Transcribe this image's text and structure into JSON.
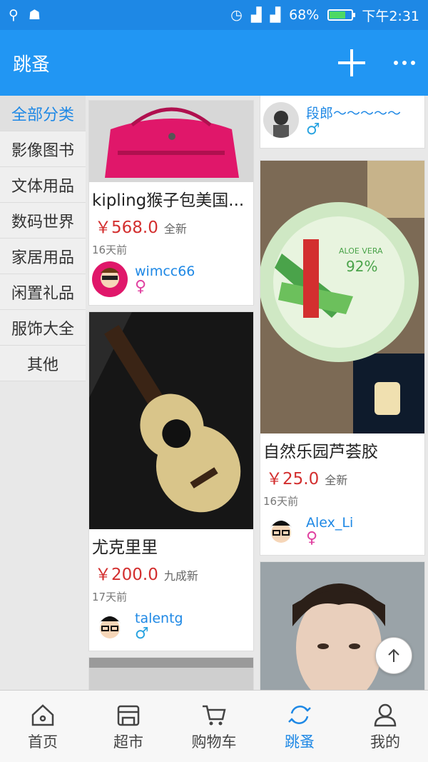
{
  "statusbar": {
    "battery": "68%",
    "time": "下午2:31",
    "battery_level": 0.68
  },
  "appbar": {
    "title": "跳蚤"
  },
  "sidebar": {
    "items": [
      {
        "label": "全部分类",
        "active": true
      },
      {
        "label": "影像图书",
        "active": false
      },
      {
        "label": "文体用品",
        "active": false
      },
      {
        "label": "数码世界",
        "active": false
      },
      {
        "label": "家居用品",
        "active": false
      },
      {
        "label": "闲置礼品",
        "active": false
      },
      {
        "label": "服饰大全",
        "active": false
      },
      {
        "label": "其他",
        "active": false
      }
    ]
  },
  "listings": {
    "left": [
      {
        "title": "kipling猴子包美国...",
        "price": "￥568.0",
        "condition": "全新",
        "date": "16天前",
        "user": "wimcc66",
        "gender": "♀"
      },
      {
        "title": "尤克里里",
        "price": "￥200.0",
        "condition": "九成新",
        "date": "17天前",
        "user": "talentg",
        "gender": "♂"
      }
    ],
    "right": [
      {
        "user": "段郎～～～～～",
        "gender": "♂"
      },
      {
        "title": "自然乐园芦荟胶",
        "price": "￥25.0",
        "condition": "全新",
        "date": "16天前",
        "user": "Alex_Li",
        "gender": "♀"
      }
    ]
  },
  "tabs": [
    {
      "label": "首页",
      "icon": "home-icon",
      "active": false
    },
    {
      "label": "超市",
      "icon": "store-icon",
      "active": false
    },
    {
      "label": "购物车",
      "icon": "cart-icon",
      "active": false
    },
    {
      "label": "跳蚤",
      "icon": "refresh-icon",
      "active": true
    },
    {
      "label": "我的",
      "icon": "user-icon",
      "active": false
    }
  ],
  "colors": {
    "primary": "#2196f3",
    "price": "#d32f2f",
    "link": "#1e88e5"
  }
}
